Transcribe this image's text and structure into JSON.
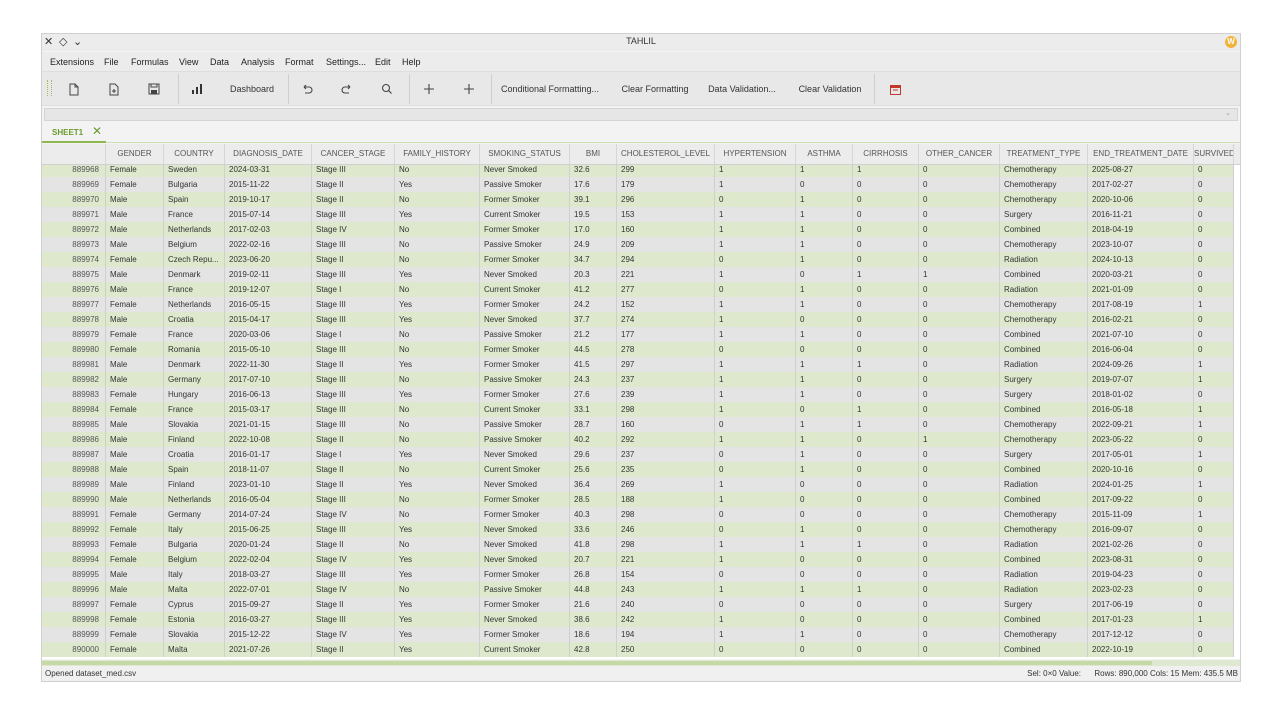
{
  "window": {
    "title": "TAHLIL",
    "controls": [
      "✕",
      "◇",
      "⌄"
    ]
  },
  "menu": [
    "Extensions",
    "File",
    "Formulas",
    "View",
    "Data",
    "Analysis",
    "Format",
    "Settings...",
    "Edit",
    "Help"
  ],
  "toolbar": {
    "new_icon": "new-file-icon",
    "open_icon": "open-file-icon",
    "save_icon": "save-icon",
    "chart_icon": "bar-chart-icon",
    "dashboard": "Dashboard",
    "undo_icon": "undo-icon",
    "redo_icon": "redo-icon",
    "search_icon": "search-icon",
    "add_row_icon": "plus-icon",
    "add_col_icon": "plus-icon",
    "conditional": "Conditional Formatting...",
    "clear_formatting": "Clear Formatting",
    "data_validation": "Data Validation...",
    "clear_validation": "Clear Validation",
    "calendar_icon": "calendar-icon",
    "accent": "#8cb84f"
  },
  "sheet": {
    "tab": "SHEET1"
  },
  "columns": [
    "GENDER",
    "COUNTRY",
    "DIAGNOSIS_DATE",
    "CANCER_STAGE",
    "FAMILY_HISTORY",
    "SMOKING_STATUS",
    "BMI",
    "CHOLESTEROL_LEVEL",
    "HYPERTENSION",
    "ASTHMA",
    "CIRRHOSIS",
    "OTHER_CANCER",
    "TREATMENT_TYPE",
    "END_TREATMENT_DATE",
    "SURVIVED"
  ],
  "rows": [
    [
      "889968",
      "Female",
      "Sweden",
      "2024-03-31",
      "Stage III",
      "No",
      "Never Smoked",
      "32.6",
      "299",
      "1",
      "1",
      "1",
      "0",
      "Chemotherapy",
      "2025-08-27",
      "0"
    ],
    [
      "889969",
      "Female",
      "Bulgaria",
      "2015-11-22",
      "Stage II",
      "Yes",
      "Passive Smoker",
      "17.6",
      "179",
      "1",
      "0",
      "0",
      "0",
      "Chemotherapy",
      "2017-02-27",
      "0"
    ],
    [
      "889970",
      "Male",
      "Spain",
      "2019-10-17",
      "Stage II",
      "No",
      "Former Smoker",
      "39.1",
      "296",
      "0",
      "1",
      "0",
      "0",
      "Chemotherapy",
      "2020-10-06",
      "0"
    ],
    [
      "889971",
      "Male",
      "France",
      "2015-07-14",
      "Stage III",
      "Yes",
      "Current Smoker",
      "19.5",
      "153",
      "1",
      "1",
      "0",
      "0",
      "Surgery",
      "2016-11-21",
      "0"
    ],
    [
      "889972",
      "Male",
      "Netherlands",
      "2017-02-03",
      "Stage IV",
      "No",
      "Former Smoker",
      "17.0",
      "160",
      "1",
      "1",
      "0",
      "0",
      "Combined",
      "2018-04-19",
      "0"
    ],
    [
      "889973",
      "Male",
      "Belgium",
      "2022-02-16",
      "Stage III",
      "No",
      "Passive Smoker",
      "24.9",
      "209",
      "1",
      "1",
      "0",
      "0",
      "Chemotherapy",
      "2023-10-07",
      "0"
    ],
    [
      "889974",
      "Female",
      "Czech Repu...",
      "2023-06-20",
      "Stage II",
      "No",
      "Former Smoker",
      "34.7",
      "294",
      "0",
      "1",
      "0",
      "0",
      "Radiation",
      "2024-10-13",
      "0"
    ],
    [
      "889975",
      "Male",
      "Denmark",
      "2019-02-11",
      "Stage III",
      "Yes",
      "Never Smoked",
      "20.3",
      "221",
      "1",
      "0",
      "1",
      "1",
      "Combined",
      "2020-03-21",
      "0"
    ],
    [
      "889976",
      "Male",
      "France",
      "2019-12-07",
      "Stage I",
      "No",
      "Current Smoker",
      "41.2",
      "277",
      "0",
      "1",
      "0",
      "0",
      "Radiation",
      "2021-01-09",
      "0"
    ],
    [
      "889977",
      "Female",
      "Netherlands",
      "2016-05-15",
      "Stage III",
      "Yes",
      "Former Smoker",
      "24.2",
      "152",
      "1",
      "1",
      "0",
      "0",
      "Chemotherapy",
      "2017-08-19",
      "1"
    ],
    [
      "889978",
      "Male",
      "Croatia",
      "2015-04-17",
      "Stage III",
      "Yes",
      "Never Smoked",
      "37.7",
      "274",
      "1",
      "0",
      "0",
      "0",
      "Chemotherapy",
      "2016-02-21",
      "0"
    ],
    [
      "889979",
      "Female",
      "France",
      "2020-03-06",
      "Stage I",
      "No",
      "Passive Smoker",
      "21.2",
      "177",
      "1",
      "1",
      "0",
      "0",
      "Combined",
      "2021-07-10",
      "0"
    ],
    [
      "889980",
      "Female",
      "Romania",
      "2015-05-10",
      "Stage III",
      "No",
      "Former Smoker",
      "44.5",
      "278",
      "0",
      "0",
      "0",
      "0",
      "Combined",
      "2016-06-04",
      "0"
    ],
    [
      "889981",
      "Male",
      "Denmark",
      "2022-11-30",
      "Stage II",
      "Yes",
      "Former Smoker",
      "41.5",
      "297",
      "1",
      "1",
      "1",
      "0",
      "Radiation",
      "2024-09-26",
      "1"
    ],
    [
      "889982",
      "Male",
      "Germany",
      "2017-07-10",
      "Stage III",
      "No",
      "Passive Smoker",
      "24.3",
      "237",
      "1",
      "1",
      "0",
      "0",
      "Surgery",
      "2019-07-07",
      "1"
    ],
    [
      "889983",
      "Female",
      "Hungary",
      "2016-06-13",
      "Stage III",
      "Yes",
      "Former Smoker",
      "27.6",
      "239",
      "1",
      "1",
      "0",
      "0",
      "Surgery",
      "2018-01-02",
      "0"
    ],
    [
      "889984",
      "Female",
      "France",
      "2015-03-17",
      "Stage III",
      "No",
      "Current Smoker",
      "33.1",
      "298",
      "1",
      "0",
      "1",
      "0",
      "Combined",
      "2016-05-18",
      "1"
    ],
    [
      "889985",
      "Male",
      "Slovakia",
      "2021-01-15",
      "Stage III",
      "No",
      "Passive Smoker",
      "28.7",
      "160",
      "0",
      "1",
      "1",
      "0",
      "Chemotherapy",
      "2022-09-21",
      "1"
    ],
    [
      "889986",
      "Male",
      "Finland",
      "2022-10-08",
      "Stage II",
      "No",
      "Passive Smoker",
      "40.2",
      "292",
      "1",
      "1",
      "0",
      "1",
      "Chemotherapy",
      "2023-05-22",
      "0"
    ],
    [
      "889987",
      "Male",
      "Croatia",
      "2016-01-17",
      "Stage I",
      "Yes",
      "Never Smoked",
      "29.6",
      "237",
      "0",
      "1",
      "0",
      "0",
      "Surgery",
      "2017-05-01",
      "1"
    ],
    [
      "889988",
      "Male",
      "Spain",
      "2018-11-07",
      "Stage II",
      "No",
      "Current Smoker",
      "25.6",
      "235",
      "0",
      "1",
      "0",
      "0",
      "Combined",
      "2020-10-16",
      "0"
    ],
    [
      "889989",
      "Male",
      "Finland",
      "2023-01-10",
      "Stage II",
      "Yes",
      "Never Smoked",
      "36.4",
      "269",
      "1",
      "0",
      "0",
      "0",
      "Radiation",
      "2024-01-25",
      "1"
    ],
    [
      "889990",
      "Male",
      "Netherlands",
      "2016-05-04",
      "Stage III",
      "No",
      "Former Smoker",
      "28.5",
      "188",
      "1",
      "0",
      "0",
      "0",
      "Combined",
      "2017-09-22",
      "0"
    ],
    [
      "889991",
      "Female",
      "Germany",
      "2014-07-24",
      "Stage IV",
      "No",
      "Former Smoker",
      "40.3",
      "298",
      "0",
      "0",
      "0",
      "0",
      "Chemotherapy",
      "2015-11-09",
      "1"
    ],
    [
      "889992",
      "Female",
      "Italy",
      "2015-06-25",
      "Stage III",
      "Yes",
      "Never Smoked",
      "33.6",
      "246",
      "0",
      "1",
      "0",
      "0",
      "Chemotherapy",
      "2016-09-07",
      "0"
    ],
    [
      "889993",
      "Female",
      "Bulgaria",
      "2020-01-24",
      "Stage II",
      "No",
      "Never Smoked",
      "41.8",
      "298",
      "1",
      "1",
      "1",
      "0",
      "Radiation",
      "2021-02-26",
      "0"
    ],
    [
      "889994",
      "Female",
      "Belgium",
      "2022-02-04",
      "Stage IV",
      "Yes",
      "Never Smoked",
      "20.7",
      "221",
      "1",
      "0",
      "0",
      "0",
      "Combined",
      "2023-08-31",
      "0"
    ],
    [
      "889995",
      "Male",
      "Italy",
      "2018-03-27",
      "Stage III",
      "Yes",
      "Former Smoker",
      "26.8",
      "154",
      "0",
      "0",
      "0",
      "0",
      "Radiation",
      "2019-04-23",
      "0"
    ],
    [
      "889996",
      "Male",
      "Malta",
      "2022-07-01",
      "Stage IV",
      "No",
      "Passive Smoker",
      "44.8",
      "243",
      "1",
      "1",
      "1",
      "0",
      "Radiation",
      "2023-02-23",
      "0"
    ],
    [
      "889997",
      "Female",
      "Cyprus",
      "2015-09-27",
      "Stage II",
      "Yes",
      "Former Smoker",
      "21.6",
      "240",
      "0",
      "0",
      "0",
      "0",
      "Surgery",
      "2017-06-19",
      "0"
    ],
    [
      "889998",
      "Female",
      "Estonia",
      "2016-03-27",
      "Stage III",
      "Yes",
      "Never Smoked",
      "38.6",
      "242",
      "1",
      "0",
      "0",
      "0",
      "Combined",
      "2017-01-23",
      "1"
    ],
    [
      "889999",
      "Female",
      "Slovakia",
      "2015-12-22",
      "Stage IV",
      "Yes",
      "Former Smoker",
      "18.6",
      "194",
      "1",
      "1",
      "0",
      "0",
      "Chemotherapy",
      "2017-12-12",
      "0"
    ],
    [
      "890000",
      "Female",
      "Malta",
      "2021-07-26",
      "Stage II",
      "Yes",
      "Current Smoker",
      "42.8",
      "250",
      "0",
      "0",
      "0",
      "0",
      "Combined",
      "2022-10-19",
      "0"
    ]
  ],
  "status": {
    "message": "Opened dataset_med.csv",
    "selection": "Sel: 0×0  Value:",
    "summary": "Rows: 890,000 Cols: 15 Mem: 435.5 MB"
  }
}
